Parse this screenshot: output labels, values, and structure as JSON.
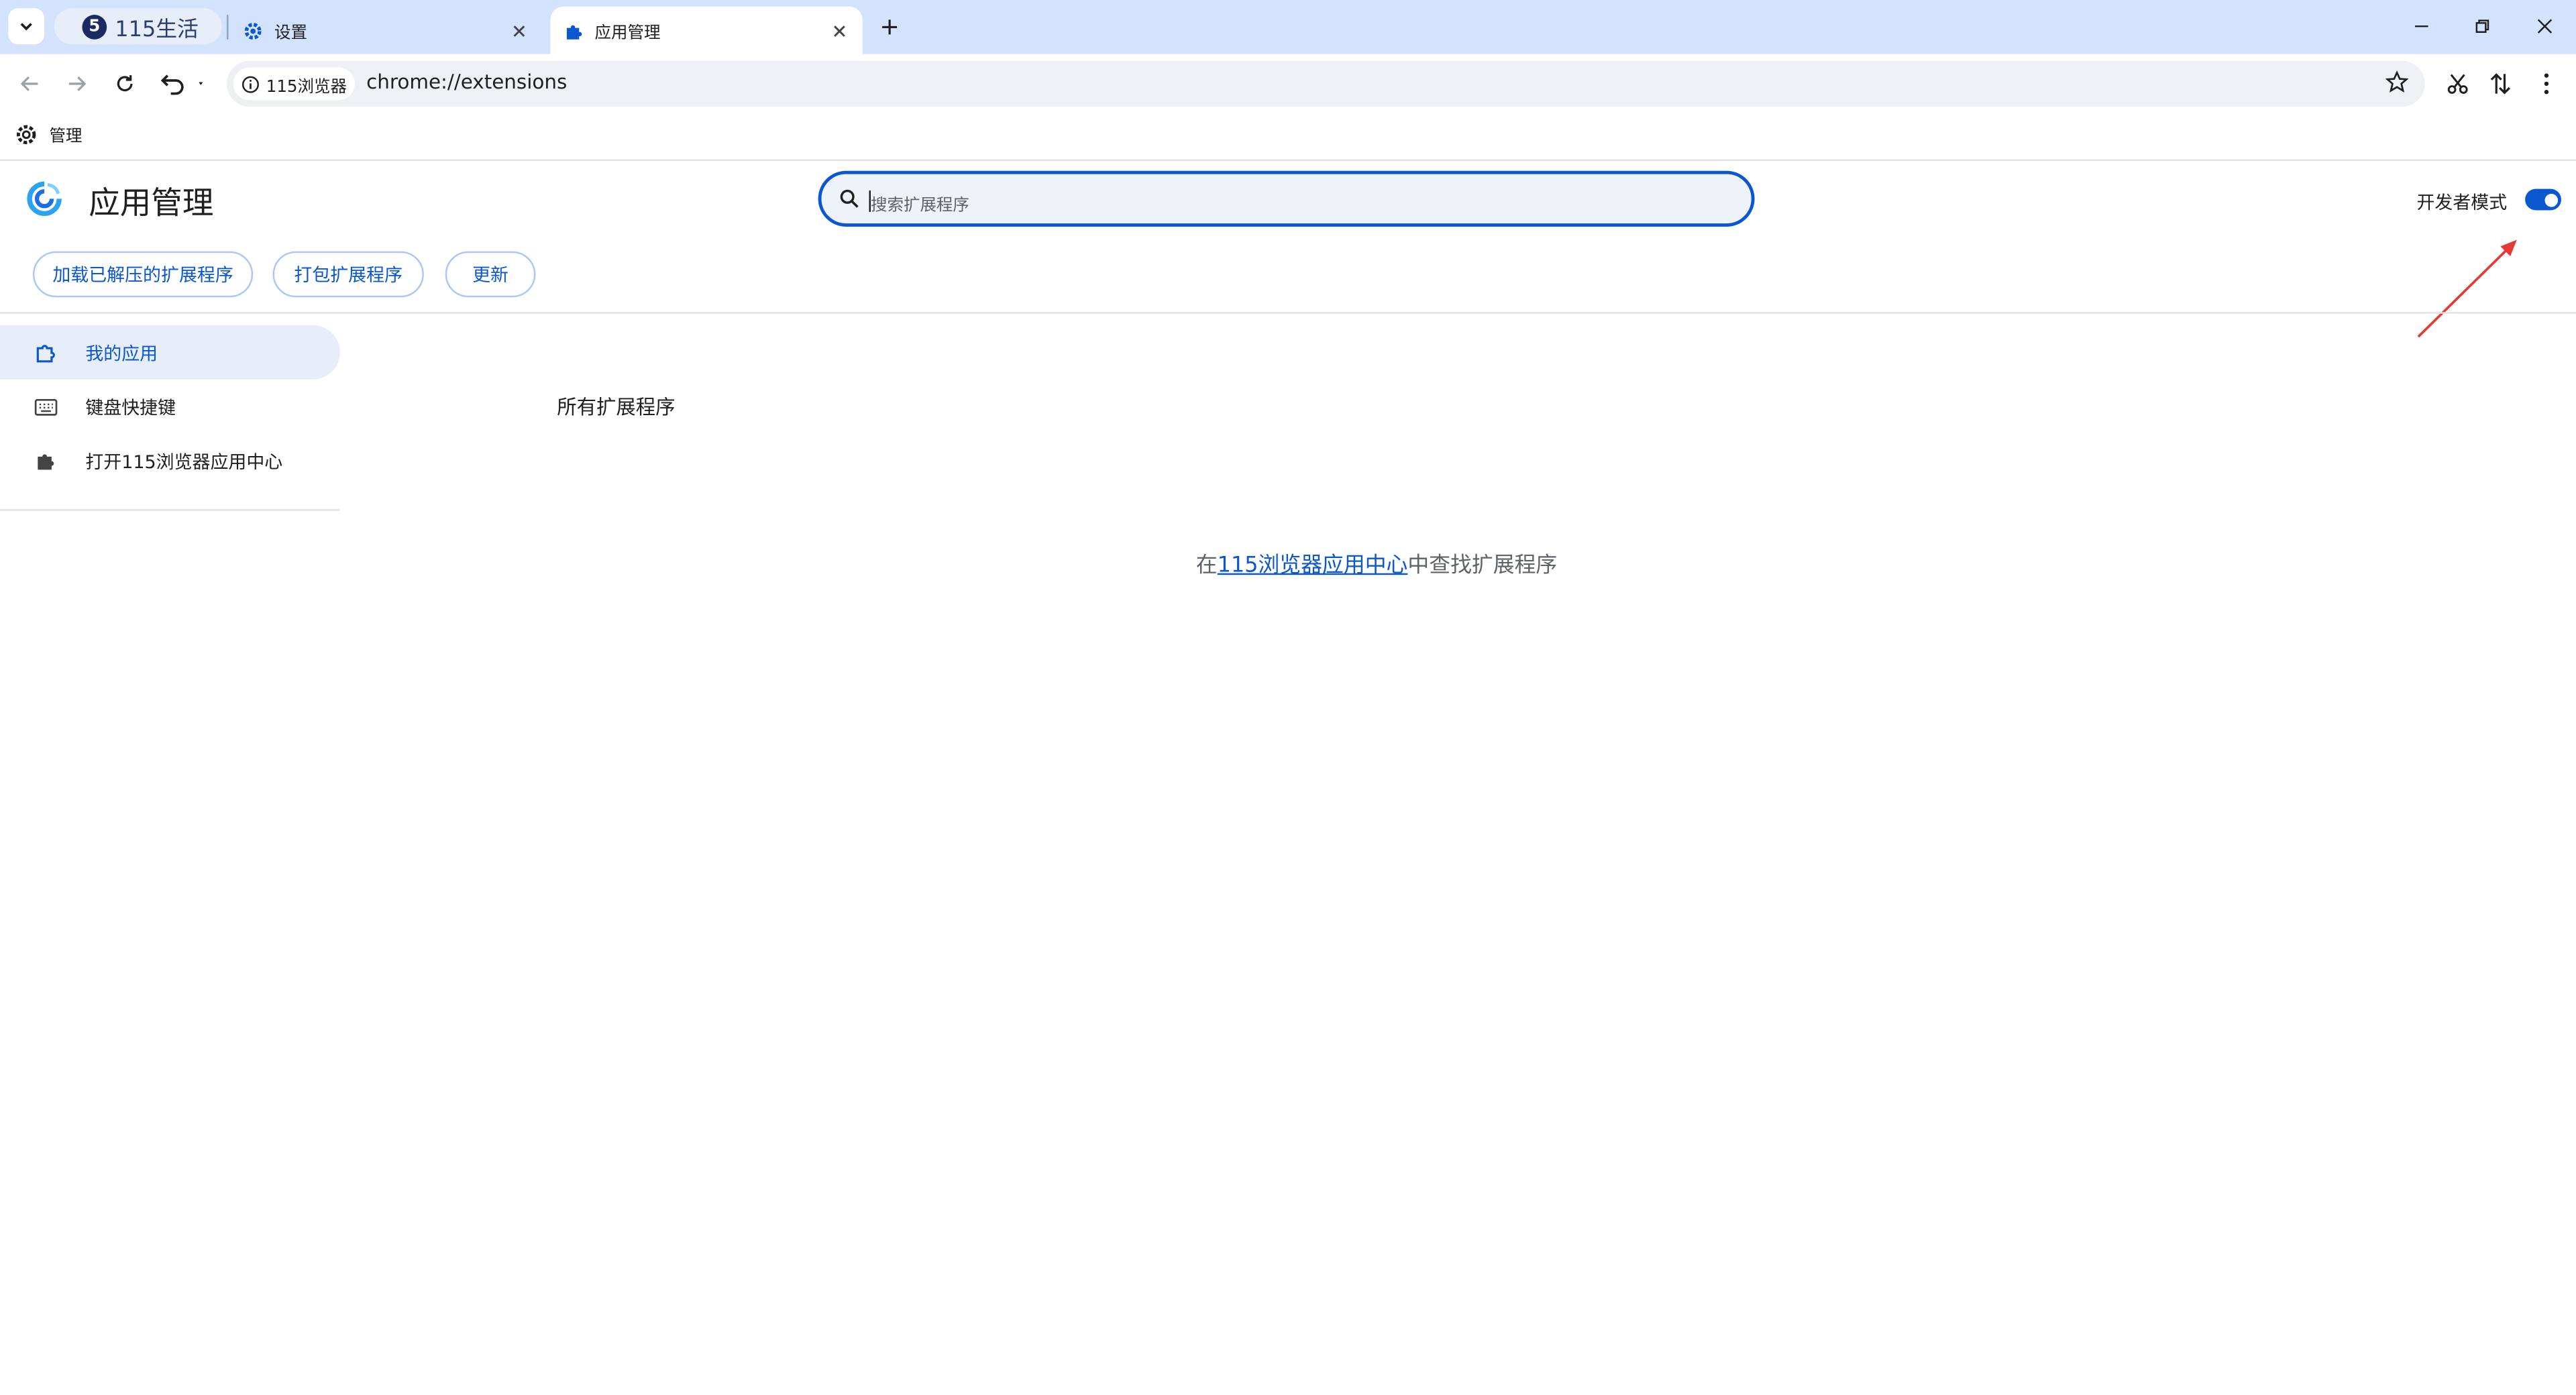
{
  "tabs": {
    "group_label": "115生活",
    "group_favicon_text": "5",
    "settings_title": "设置",
    "active_title": "应用管理"
  },
  "toolbar": {
    "site_chip": "115浏览器",
    "url": "chrome://extensions"
  },
  "bookmarks": {
    "manage_label": "管理"
  },
  "header": {
    "title": "应用管理",
    "search_placeholder": "搜索扩展程序",
    "developer_mode_label": "开发者模式",
    "developer_mode_on": true
  },
  "actions": {
    "load_unpacked": "加载已解压的扩展程序",
    "pack": "打包扩展程序",
    "update": "更新"
  },
  "sidebar": {
    "items": [
      {
        "label": "我的应用",
        "icon": "extensions-icon",
        "active": true
      },
      {
        "label": "键盘快捷键",
        "icon": "keyboard-icon",
        "active": false
      },
      {
        "label": "打开115浏览器应用中心",
        "icon": "puzzle-icon",
        "active": false
      }
    ]
  },
  "main": {
    "section_heading": "所有扩展程序",
    "empty_prefix": "在",
    "empty_link": "115浏览器应用中心",
    "empty_suffix": "中查找扩展程序"
  },
  "colors": {
    "accent": "#0b57d0",
    "tabstrip": "#d3e3fd",
    "annotation_arrow": "#e53935"
  }
}
